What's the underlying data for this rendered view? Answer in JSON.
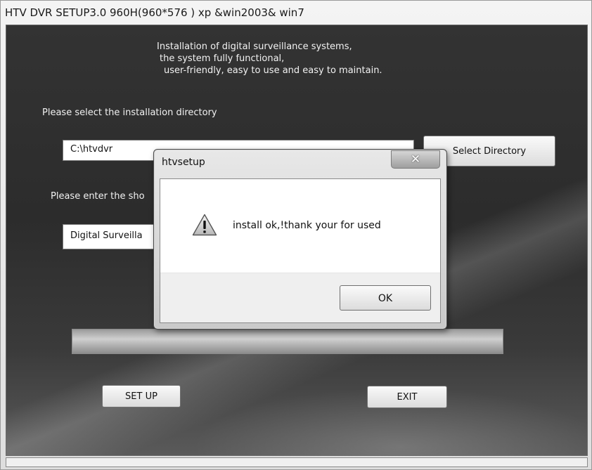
{
  "window": {
    "title": "HTV  DVR  SETUP3.0   960H(960*576 )  xp &win2003& win7"
  },
  "intro": {
    "line1": "Installation of digital surveillance systems,",
    "line2": "the system fully functional,",
    "line3": "user-friendly, easy to use and easy to maintain."
  },
  "directory": {
    "label": "Please select the installation directory",
    "value": "C:\\htvdvr",
    "select_button": "Select Directory"
  },
  "shortcut": {
    "label": "Please enter the sho",
    "value": "Digital Surveilla"
  },
  "buttons": {
    "setup": "SET UP",
    "exit": "EXIT"
  },
  "dialog": {
    "title": "htvsetup",
    "close_glyph": "✕",
    "message": "install ok,!thank your for used",
    "ok": "OK",
    "icon": "warning-icon"
  }
}
